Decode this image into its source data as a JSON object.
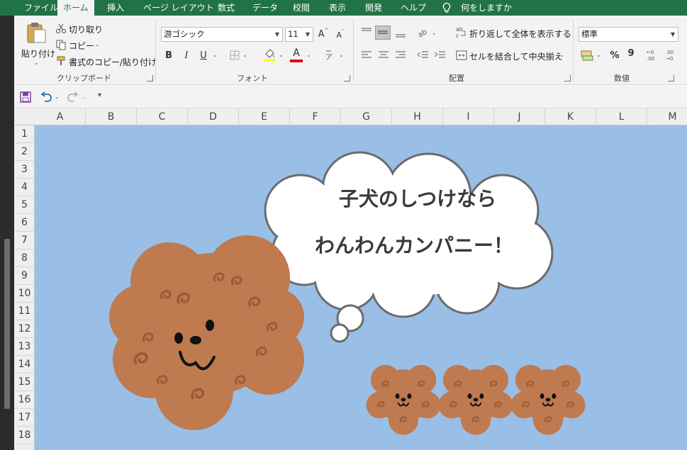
{
  "ribbon_tabs": [
    {
      "label": "ファイル",
      "active": false
    },
    {
      "label": "ホーム",
      "active": true
    },
    {
      "label": "挿入",
      "active": false
    },
    {
      "label": "ページ レイアウト",
      "active": false
    },
    {
      "label": "数式",
      "active": false
    },
    {
      "label": "データ",
      "active": false
    },
    {
      "label": "校閲",
      "active": false
    },
    {
      "label": "表示",
      "active": false
    },
    {
      "label": "開発",
      "active": false
    },
    {
      "label": "ヘルプ",
      "active": false
    }
  ],
  "tell_me": "何をしますか",
  "clipboard": {
    "paste_label": "貼り付け",
    "cut_label": "切り取り",
    "copy_label": "コピー",
    "format_painter_label": "書式のコピー/貼り付け",
    "group_label": "クリップボード"
  },
  "font": {
    "font_name": "游ゴシック",
    "font_size": "11",
    "group_label": "フォント",
    "bold": "B",
    "italic": "I",
    "underline": "U",
    "grow": "A",
    "shrink": "A",
    "font_color_letter": "A"
  },
  "alignment": {
    "wrap_text_label": "折り返して全体を表示する",
    "merge_center_label": "セルを結合して中央揃え",
    "group_label": "配置"
  },
  "number": {
    "format": "標準",
    "percent": "%",
    "comma": "9",
    "group_label": "数値"
  },
  "columns": [
    "A",
    "B",
    "C",
    "D",
    "E",
    "F",
    "G",
    "H",
    "I",
    "J",
    "K",
    "L",
    "M"
  ],
  "rows": [
    "1",
    "2",
    "3",
    "4",
    "5",
    "6",
    "7",
    "8",
    "9",
    "10",
    "11",
    "12",
    "13",
    "14",
    "15",
    "16",
    "17",
    "18"
  ],
  "bubble": {
    "line1": "子犬のしつけなら",
    "line2": "わんわんカンパニー！"
  },
  "colors": {
    "ribbon_green": "#217346",
    "sheet_background": "#99bfe6",
    "poodle_brown": "#bf7a4f",
    "poodle_curl": "#9c5a36",
    "bubble_outline": "#6b6b6b",
    "font_color_bar": "#e00000",
    "fill_color_bar": "#ffff00"
  },
  "icons": {
    "save": "save-icon",
    "undo": "undo-icon",
    "redo": "redo-icon",
    "tell_me": "lightbulb-icon"
  }
}
